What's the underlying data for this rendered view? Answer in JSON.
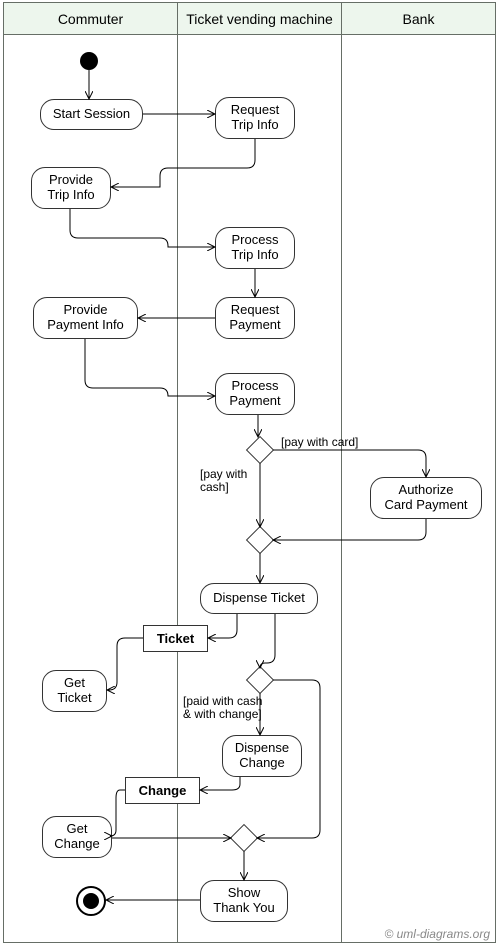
{
  "lanes": {
    "commuter": "Commuter",
    "tvm": "Ticket vending machine",
    "bank": "Bank"
  },
  "activities": {
    "start_session": "Start Session",
    "request_trip_info": "Request\nTrip Info",
    "provide_trip_info": "Provide\nTrip Info",
    "process_trip_info": "Process\nTrip Info",
    "request_payment": "Request\nPayment",
    "provide_payment_info": "Provide\nPayment Info",
    "process_payment": "Process\nPayment",
    "authorize_card": "Authorize\nCard Payment",
    "dispense_ticket": "Dispense Ticket",
    "get_ticket": "Get\nTicket",
    "dispense_change": "Dispense\nChange",
    "get_change": "Get\nChange",
    "show_thank_you": "Show\nThank You"
  },
  "objects": {
    "ticket": "Ticket",
    "change": "Change"
  },
  "guards": {
    "pay_card": "[pay with card]",
    "pay_cash": "[pay with\ncash]",
    "paid_cash_change": "[paid with cash\n& with change]"
  },
  "copyright": "© uml-diagrams.org"
}
